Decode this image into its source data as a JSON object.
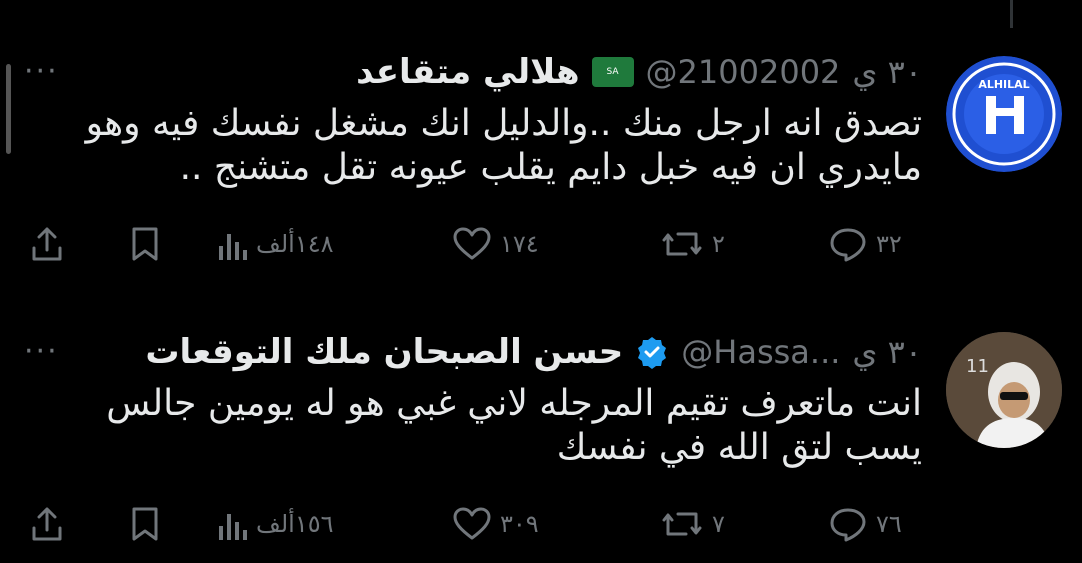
{
  "tweets": [
    {
      "name": "هلالي متقاعد",
      "handle": "@21002002",
      "time": "٣٠ ي",
      "more": "···",
      "flag_label": "SA",
      "text": "تصدق انه ارجل منك ..والدليل انك مشغل نفسك فيه وهو مايدري ان فيه خبل دايم يقلب عيونه تقل متشنج ..",
      "counts": {
        "replies": "٣٢",
        "retweets": "٢",
        "likes": "١٧٤",
        "views": "١٤٨ألف"
      },
      "avatar_text": "ALHILAL"
    },
    {
      "name": "حسن الصبحان ملك التوقعات",
      "handle": "@Hassa...",
      "time": "٣٠ ي",
      "more": "···",
      "text": "انت ماتعرف تقيم المرجله لاني غبي هو له يومين جالس يسب لتق الله في نفسك",
      "counts": {
        "replies": "٧٦",
        "retweets": "٧",
        "likes": "٣٠٩",
        "views": "١٥٦ألف"
      },
      "avatar_text": "11"
    }
  ],
  "colors": {
    "background": "#000000",
    "text": "#e7e9ea",
    "muted": "#71767b",
    "verified": "#1d9bf0",
    "hilal_blue": "#1f4fd1"
  }
}
